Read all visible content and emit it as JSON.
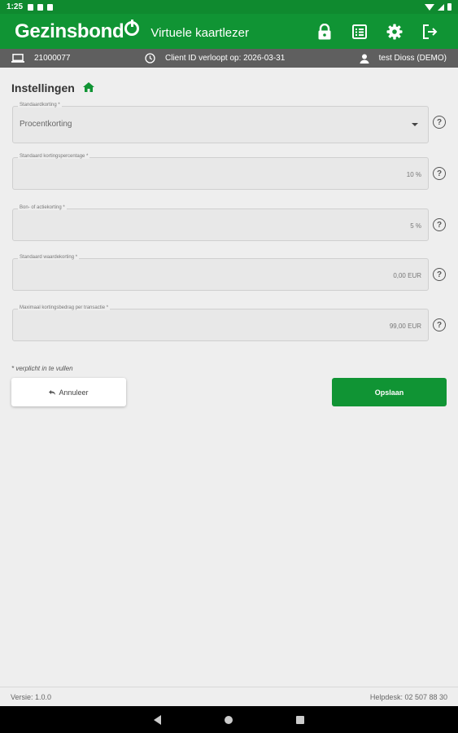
{
  "status": {
    "time": "1:25"
  },
  "header": {
    "brand": "Gezinsbond",
    "subtitle": "Virtuele kaartlezer"
  },
  "info": {
    "device_id": "21000077",
    "client_expiry": "Client ID verloopt op: 2026-03-31",
    "user": "test Dioss (DEMO)"
  },
  "page": {
    "title": "Instellingen"
  },
  "fields": [
    {
      "label": "Standaardkorting *",
      "value": "Procentkorting"
    },
    {
      "label": "Standaard kortingspercentage *",
      "value": "10 %"
    },
    {
      "label": "Bon- of actiekorting *",
      "value": "5 %"
    },
    {
      "label": "Standaard waardekorting *",
      "value": "0,00 EUR"
    },
    {
      "label": "Maximaal kortingsbedrag per transactie *",
      "value": "99,00 EUR"
    }
  ],
  "help_symbol": "?",
  "form": {
    "required_note": "* verplicht in te vullen",
    "cancel_label": "Annuleer",
    "save_label": "Opslaan"
  },
  "footer": {
    "version": "Versie: 1.0.0",
    "helpdesk": "Helpdesk: 02 507 88 30"
  }
}
